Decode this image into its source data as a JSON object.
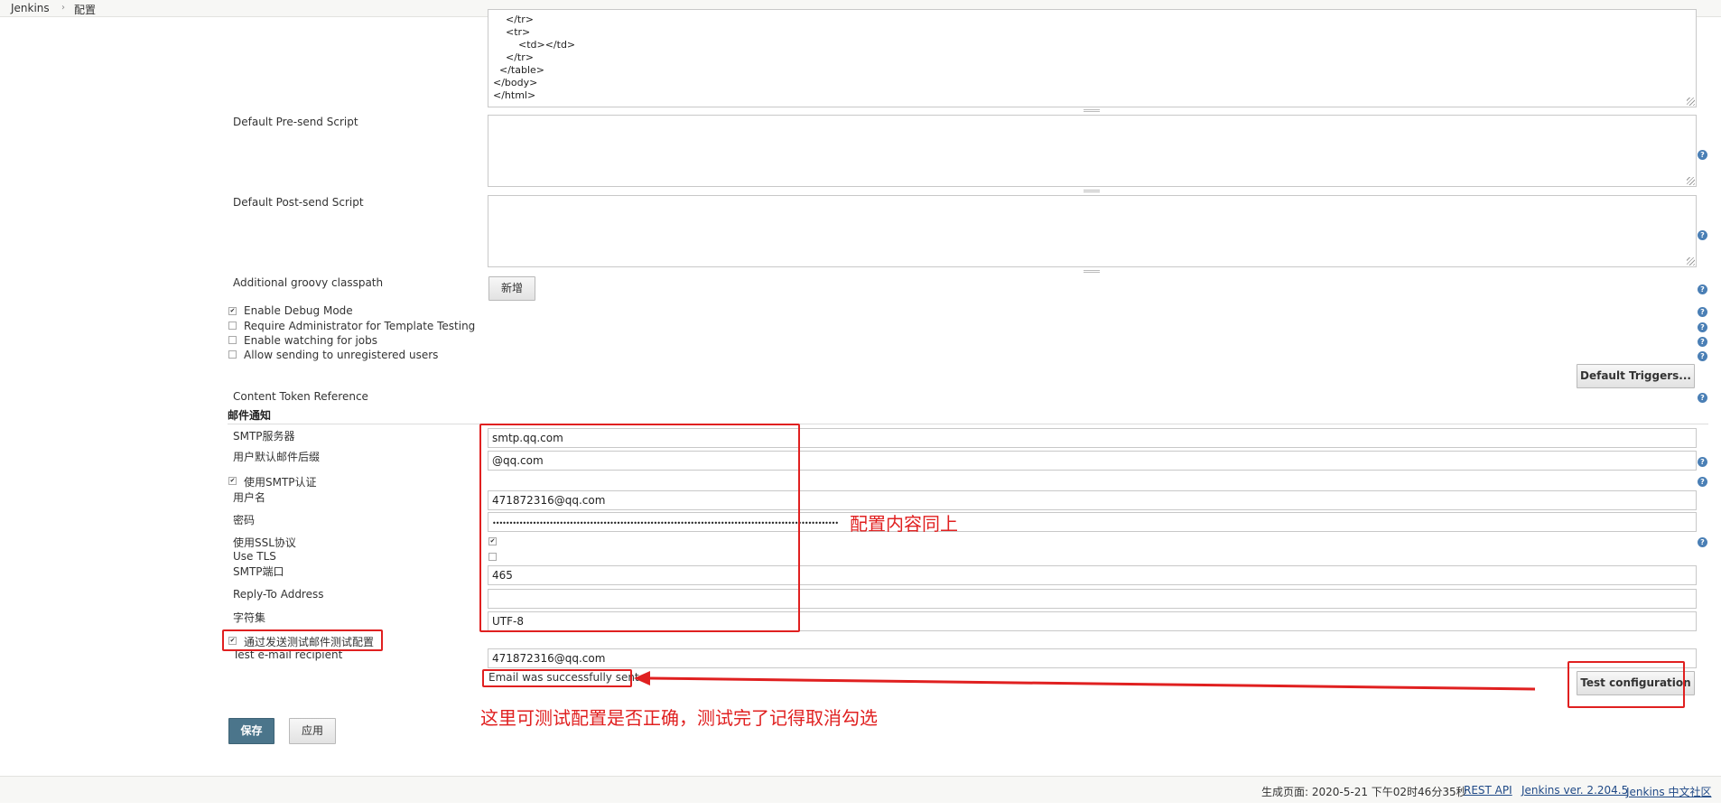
{
  "breadcrumb": {
    "root": "Jenkins",
    "separator": "›",
    "current": "配置"
  },
  "code_lines": [
    "    </tr>",
    "    <tr>",
    "        <td></td>",
    "    </tr>",
    "  </table>",
    "</body>",
    "</html>"
  ],
  "fields": {
    "pre_send_label": "Default Pre-send Script",
    "post_send_label": "Default Post-send Script",
    "groovy_label": "Additional groovy classpath",
    "groovy_add_button": "新增",
    "debug_mode_label": "Enable Debug Mode",
    "require_admin_label": "Require Administrator for Template Testing",
    "watching_label": "Enable watching for jobs",
    "unregistered_label": "Allow sending to unregistered users",
    "default_triggers_button": "Default Triggers...",
    "content_token_label": "Content Token Reference"
  },
  "mail": {
    "section_title": "邮件通知",
    "smtp_server_label": "SMTP服务器",
    "smtp_server_value": "smtp.qq.com",
    "suffix_label": "用户默认邮件后缀",
    "suffix_value": "@qq.com",
    "smtp_auth_label": "使用SMTP认证",
    "username_label": "用户名",
    "username_value": "471872316@qq.com",
    "password_label": "密码",
    "password_value": "•••••••••••••••••••••••••••••••••••••••••••••••••••••••••••••••••••••••••••••••••••••••••••••••••••••••",
    "ssl_label": "使用SSL协议",
    "tls_label": "Use TLS",
    "port_label": "SMTP端口",
    "port_value": "465",
    "reply_to_label": "Reply-To Address",
    "reply_to_value": "",
    "charset_label": "字符集",
    "charset_value": "UTF-8",
    "test_checkbox_label": "通过发送测试邮件测试配置",
    "test_recipient_label": "Test e-mail recipient",
    "test_recipient_value": "471872316@qq.com",
    "success_message": "Email was successfully sent",
    "test_button": "Test configuration"
  },
  "buttons": {
    "save": "保存",
    "apply": "应用"
  },
  "annotations": {
    "same_config": "配置内容同上",
    "test_note": "这里可测试配置是否正确，测试完了记得取消勾选"
  },
  "footer": {
    "generated": "生成页面: 2020-5-21 下午02时46分35秒",
    "rest_api": "REST API",
    "version": "Jenkins ver. 2.204.5",
    "community": "Jenkins 中文社区"
  },
  "colors": {
    "annotation_red": "#e02020",
    "save_button": "#4b758b",
    "link": "#204a87"
  }
}
